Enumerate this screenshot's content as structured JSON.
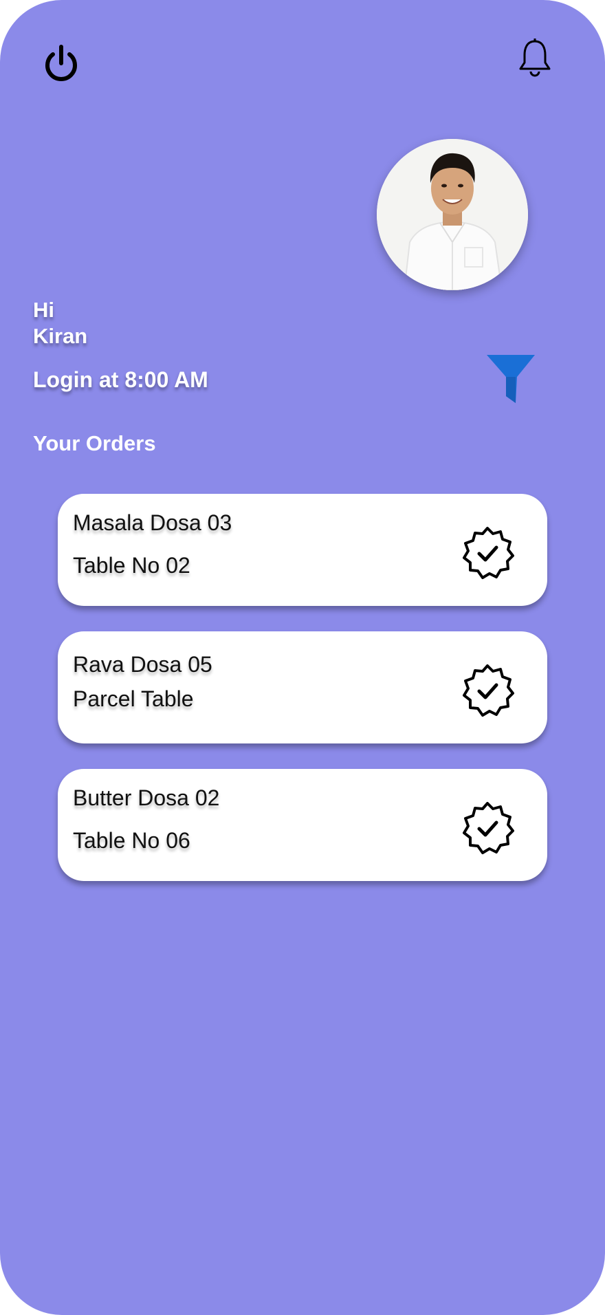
{
  "header": {
    "power_icon": "power-icon",
    "notification_icon": "bell-icon"
  },
  "profile": {
    "avatar": "avatar-photo",
    "greeting_line1": "Hi",
    "greeting_line2": "Kiran",
    "login_text": "Login at 8:00 AM"
  },
  "filter": {
    "icon": "filter-icon",
    "color": "#1a6fd6"
  },
  "orders": {
    "title": "Your Orders",
    "items": [
      {
        "name": "Masala Dosa 03",
        "table": "Table No 02",
        "status_icon": "verified-check-icon"
      },
      {
        "name": "Rava Dosa 05",
        "table": "Parcel Table",
        "status_icon": "verified-check-icon"
      },
      {
        "name": "Butter Dosa 02",
        "table": "Table No 06",
        "status_icon": "verified-check-icon"
      }
    ]
  },
  "colors": {
    "background": "#8b8ae9",
    "card": "#ffffff",
    "text_light": "#ffffff",
    "text_dark": "#111111"
  }
}
